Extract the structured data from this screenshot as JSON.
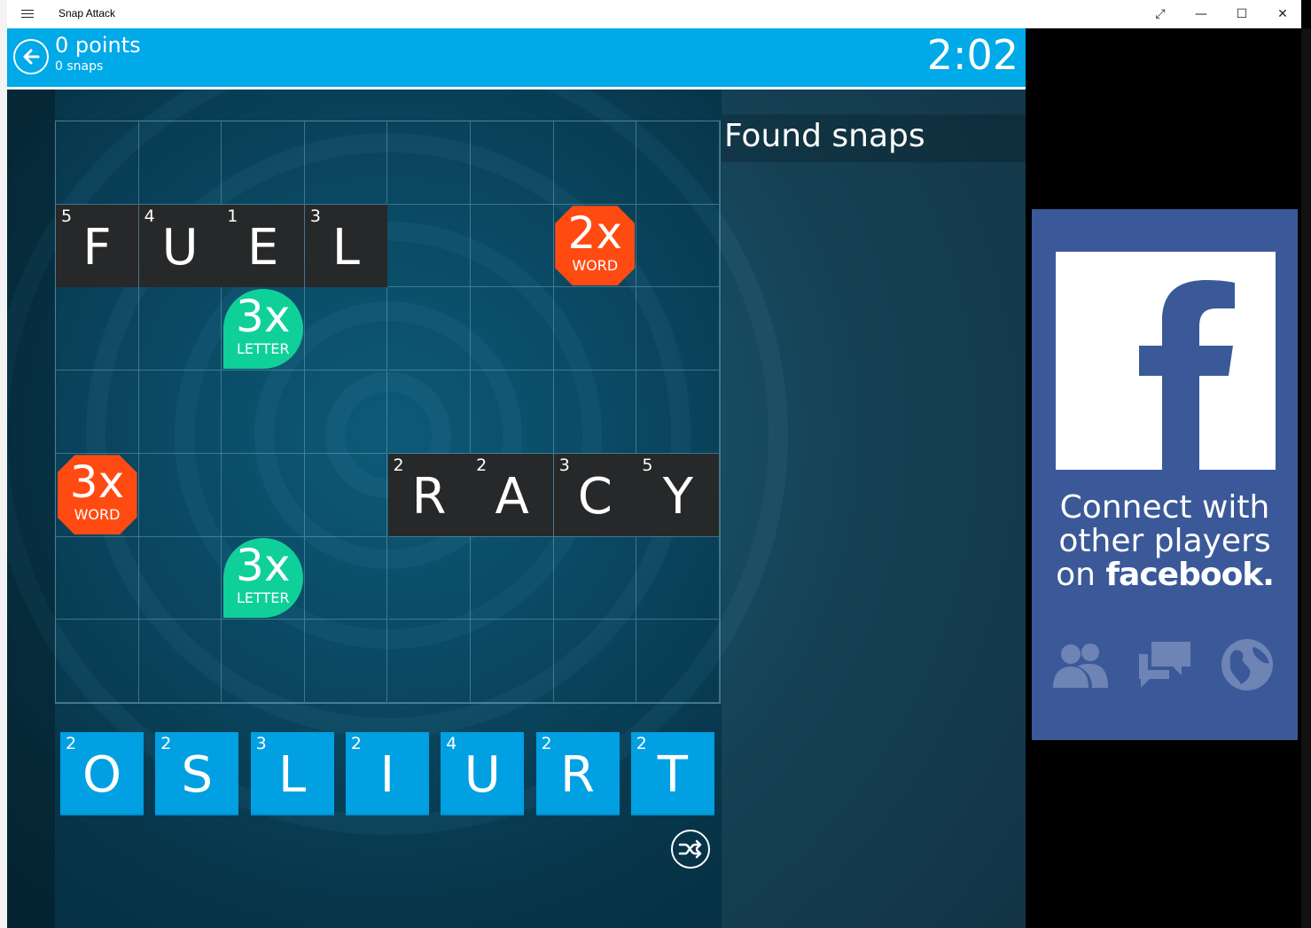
{
  "window": {
    "title": "Snap Attack",
    "controls": [
      "⤢",
      "—",
      "☐",
      "✕"
    ]
  },
  "header": {
    "points": "0 points",
    "snaps": "0 snaps",
    "timer": "2:02"
  },
  "board": {
    "rows": 7,
    "cols": 8,
    "placed_tiles": [
      {
        "letter": "F",
        "points": "5",
        "row": 1,
        "col": 0
      },
      {
        "letter": "U",
        "points": "4",
        "row": 1,
        "col": 1
      },
      {
        "letter": "E",
        "points": "1",
        "row": 1,
        "col": 2
      },
      {
        "letter": "L",
        "points": "3",
        "row": 1,
        "col": 3
      },
      {
        "letter": "R",
        "points": "2",
        "row": 4,
        "col": 4
      },
      {
        "letter": "A",
        "points": "2",
        "row": 4,
        "col": 5
      },
      {
        "letter": "C",
        "points": "3",
        "row": 4,
        "col": 6
      },
      {
        "letter": "Y",
        "points": "5",
        "row": 4,
        "col": 7
      }
    ],
    "bonuses": [
      {
        "mult": "2x",
        "kind": "WORD",
        "type": "word",
        "row": 1,
        "col": 6
      },
      {
        "mult": "3x",
        "kind": "LETTER",
        "type": "letter",
        "row": 2,
        "col": 2
      },
      {
        "mult": "3x",
        "kind": "WORD",
        "type": "word",
        "row": 4,
        "col": 0
      },
      {
        "mult": "3x",
        "kind": "LETTER",
        "type": "letter",
        "row": 5,
        "col": 2
      }
    ],
    "colors": {
      "word_bonus": "#ff4a12",
      "letter_bonus": "#10d09a",
      "placed_tile": "#272829"
    }
  },
  "rack": [
    {
      "letter": "O",
      "points": "2"
    },
    {
      "letter": "S",
      "points": "2"
    },
    {
      "letter": "L",
      "points": "3"
    },
    {
      "letter": "I",
      "points": "2"
    },
    {
      "letter": "U",
      "points": "4"
    },
    {
      "letter": "R",
      "points": "2"
    },
    {
      "letter": "T",
      "points": "2"
    }
  ],
  "found": {
    "title": "Found snaps",
    "items": []
  },
  "ad": {
    "line1": "Connect with",
    "line2": "other players",
    "line3_prefix": "on",
    "brand": "facebook",
    "icons": [
      "friends-icon",
      "chat-icon",
      "globe-icon"
    ],
    "color": "#3b5998"
  },
  "colors": {
    "accent": "#00a9e8",
    "rack_tile": "#00a0e2"
  }
}
